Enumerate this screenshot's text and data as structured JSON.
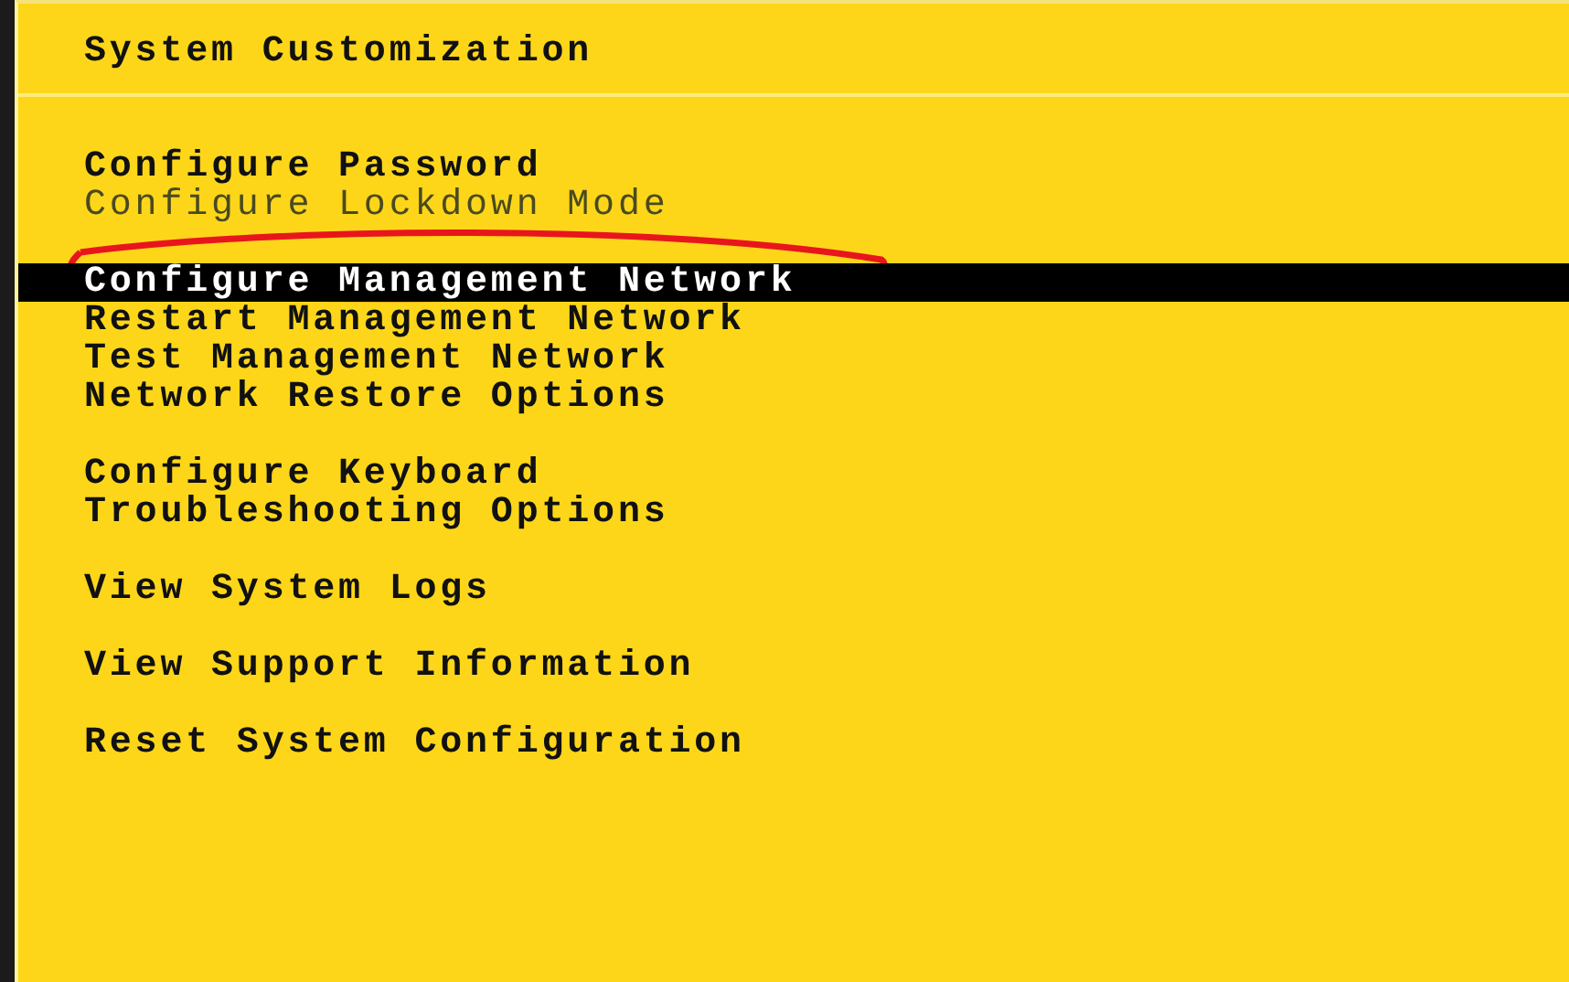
{
  "title": "System Customization",
  "menu_groups": [
    {
      "items": [
        {
          "label": "Configure Password",
          "selected": false,
          "disabled": false
        },
        {
          "label": "Configure Lockdown Mode",
          "selected": false,
          "disabled": true
        }
      ]
    },
    {
      "items": [
        {
          "label": "Configure Management Network",
          "selected": true,
          "disabled": false
        },
        {
          "label": "Restart Management Network",
          "selected": false,
          "disabled": false
        },
        {
          "label": "Test Management Network",
          "selected": false,
          "disabled": false
        },
        {
          "label": "Network Restore Options",
          "selected": false,
          "disabled": false
        }
      ]
    },
    {
      "items": [
        {
          "label": "Configure Keyboard",
          "selected": false,
          "disabled": false
        },
        {
          "label": "Troubleshooting Options",
          "selected": false,
          "disabled": false
        }
      ]
    },
    {
      "items": [
        {
          "label": "View System Logs",
          "selected": false,
          "disabled": false
        }
      ]
    },
    {
      "items": [
        {
          "label": "View Support Information",
          "selected": false,
          "disabled": false
        }
      ]
    },
    {
      "items": [
        {
          "label": "Reset System Configuration",
          "selected": false,
          "disabled": false
        }
      ]
    }
  ]
}
